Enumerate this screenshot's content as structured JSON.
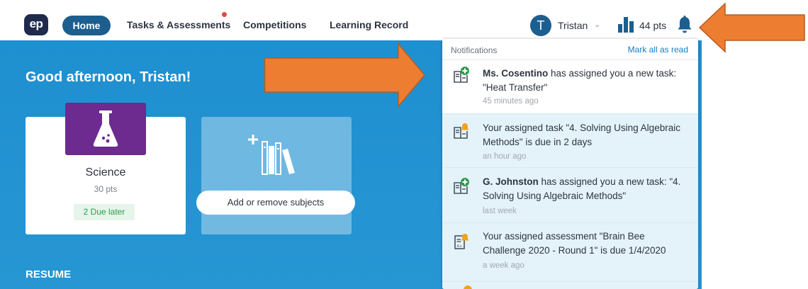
{
  "nav": {
    "logo": "ep",
    "home": "Home",
    "tasks": "Tasks & Assessments",
    "competitions": "Competitions",
    "learning_record": "Learning Record"
  },
  "user": {
    "initial": "T",
    "name": "Tristan",
    "points": "44 pts"
  },
  "hero": {
    "greeting": "Good afternoon, Tristan!",
    "resume_heading": "RESUME"
  },
  "subject": {
    "name": "Science",
    "points": "30 pts",
    "due": "2 Due later"
  },
  "add_subjects": {
    "label": "Add or remove subjects"
  },
  "notifications": {
    "title": "Notifications",
    "mark_all": "Mark all as read",
    "items": [
      {
        "sender": "Ms. Cosentino",
        "message": " has assigned you a new task: \"Heat Transfer\"",
        "time": "45 minutes ago",
        "icon": "task-assigned-icon"
      },
      {
        "sender": "",
        "message": "Your assigned task \"4. Solving Using Algebraic Methods\" is due in 2 days",
        "time": "an hour ago",
        "icon": "task-due-icon"
      },
      {
        "sender": "G. Johnston",
        "message": " has assigned you a new task: \"4. Solving Using Algebraic Methods\"",
        "time": "last week",
        "icon": "task-assigned-icon"
      },
      {
        "sender": "",
        "message": "Your assigned assessment \"Brain Bee Challenge 2020 - Round 1\" is due 1/4/2020",
        "time": "a week ago",
        "icon": "assessment-due-icon"
      }
    ]
  },
  "colors": {
    "accent": "#1c5e8e",
    "hero_blue": "#1e8fd0",
    "science_purple": "#6d2a8f",
    "annotation_orange": "#ed7d31"
  }
}
